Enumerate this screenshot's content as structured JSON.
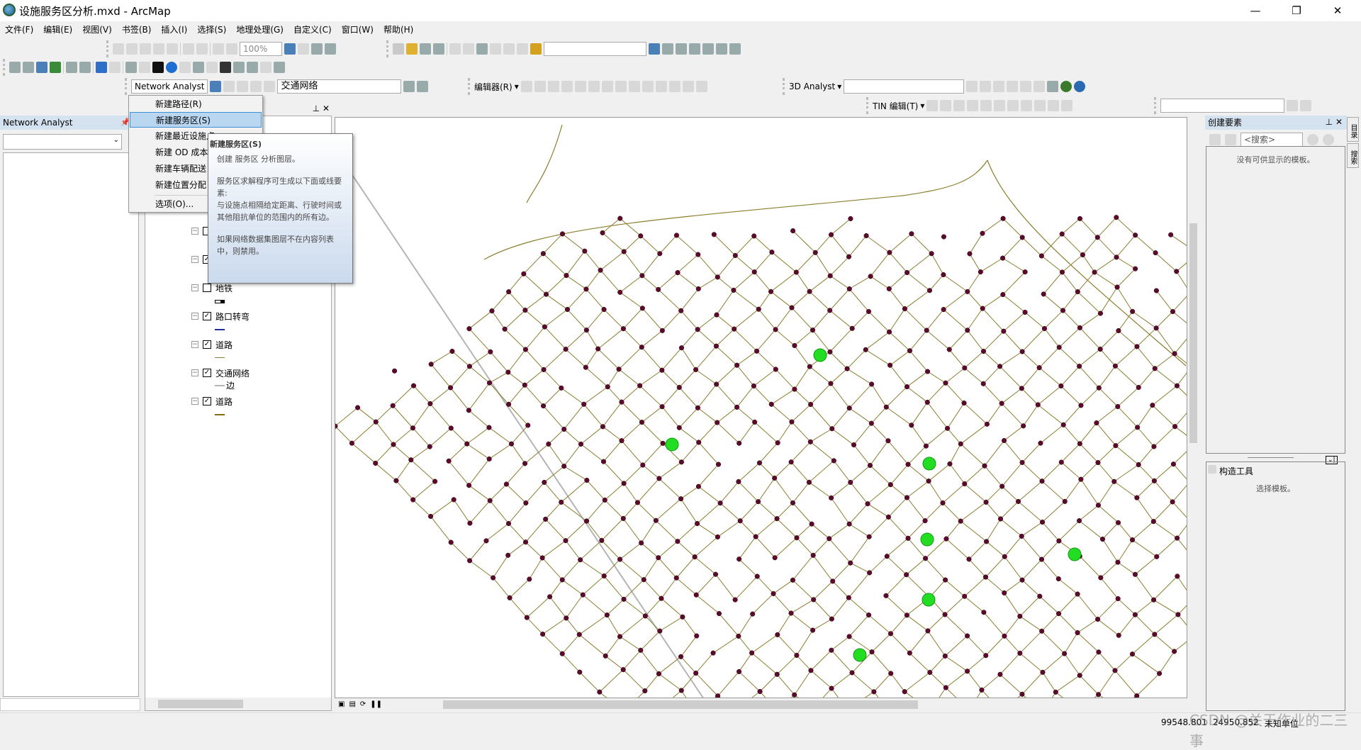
{
  "window": {
    "title": "设施服务区分析.mxd - ArcMap",
    "minimize": "—",
    "restore": "❐",
    "close": "✕"
  },
  "menubar": [
    "文件(F)",
    "编辑(E)",
    "视图(V)",
    "书签(B)",
    "插入(I)",
    "选择(S)",
    "地理处理(G)",
    "自定义(C)",
    "窗口(W)",
    "帮助(H)"
  ],
  "toolbar": {
    "zoom_level": "100%",
    "network_analyst_label": "Network Analyst",
    "network_dataset": "交通网络",
    "editor_label": "编辑器(R)",
    "analyst3d_label": "3D Analyst",
    "tin_edit_label": "TIN 编辑(T)"
  },
  "na_menu": {
    "items": [
      "新建路径(R)",
      "新建服务区(S)",
      "新建最近设施点",
      "新建 OD 成本矩阵",
      "新建车辆配送",
      "新建位置分配",
      "选项(O)..."
    ],
    "selected_index": 1
  },
  "tooltip": {
    "title": "新建服务区(S)",
    "line1": "创建 服务区 分析图层。",
    "line2": "服务区求解程序可生成以下面或线要素:",
    "line3": "与设施点相隔给定距离、行驶时间或其他阻抗单位的范围内的所有边。",
    "line4": "如果网络数据集图层不在内容列表中，则禁用。"
  },
  "na_panel": {
    "title": "Network Analyst"
  },
  "toc": {
    "layers": [
      {
        "name": "",
        "checked": false
      },
      {
        "name": "",
        "checked": true
      },
      {
        "name": "地铁",
        "checked": false,
        "legend": ""
      },
      {
        "name": "路口转弯",
        "checked": true,
        "legend": ""
      },
      {
        "name": "道路",
        "checked": true,
        "legend": ""
      },
      {
        "name": "交通网络",
        "checked": true,
        "legend": "边"
      },
      {
        "name": "道路",
        "checked": true,
        "legend": ""
      }
    ]
  },
  "right_panel": {
    "title": "创建要素",
    "search_placeholder": "<搜索>",
    "empty_msg": "没有可供显示的模板。",
    "construct_title": "构造工具",
    "construct_msg": "选择模板。"
  },
  "side_tabs": [
    "目录",
    "搜索"
  ],
  "status": {
    "x": "99548.801",
    "y": "24950.852",
    "units": "未知单位",
    "watermark": "CSDN @关于作业的二三事"
  },
  "colors": {
    "road": "#8a7f2e",
    "junction": "#5c0a2c",
    "facility": "#22dd22",
    "subway": "#b5b5b5",
    "panel_header": "#d5e2f0"
  }
}
